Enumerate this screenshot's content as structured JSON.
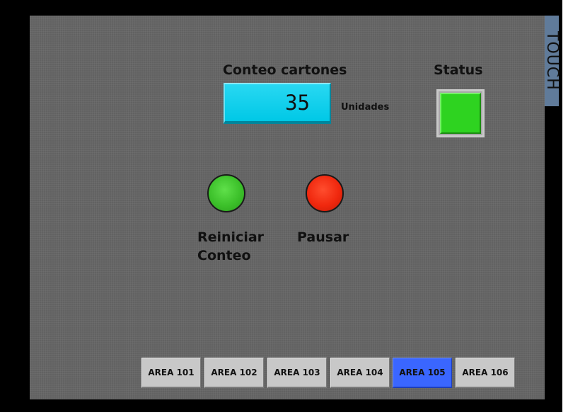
{
  "side_label": "TOUCH",
  "counter": {
    "title": "Conteo cartones",
    "value": "35",
    "units": "Unidades"
  },
  "status": {
    "title": "Status",
    "state_color": "#2ed320"
  },
  "buttons": {
    "reset": {
      "label_line1": "Reiniciar",
      "label_line2": "Conteo",
      "color": "#3cc02a"
    },
    "pause": {
      "label": "Pausar",
      "color": "#f0280e"
    }
  },
  "areas": {
    "active_index": 4,
    "active_color": "#3a66ff",
    "tabs": [
      {
        "label": "AREA 101"
      },
      {
        "label": "AREA 102"
      },
      {
        "label": "AREA 103"
      },
      {
        "label": "AREA 104"
      },
      {
        "label": "AREA 105"
      },
      {
        "label": "AREA 106"
      }
    ]
  },
  "colors": {
    "panel_background": "#626262",
    "counter_background": "#00c8e6",
    "side_label_background": "#607b9a"
  }
}
